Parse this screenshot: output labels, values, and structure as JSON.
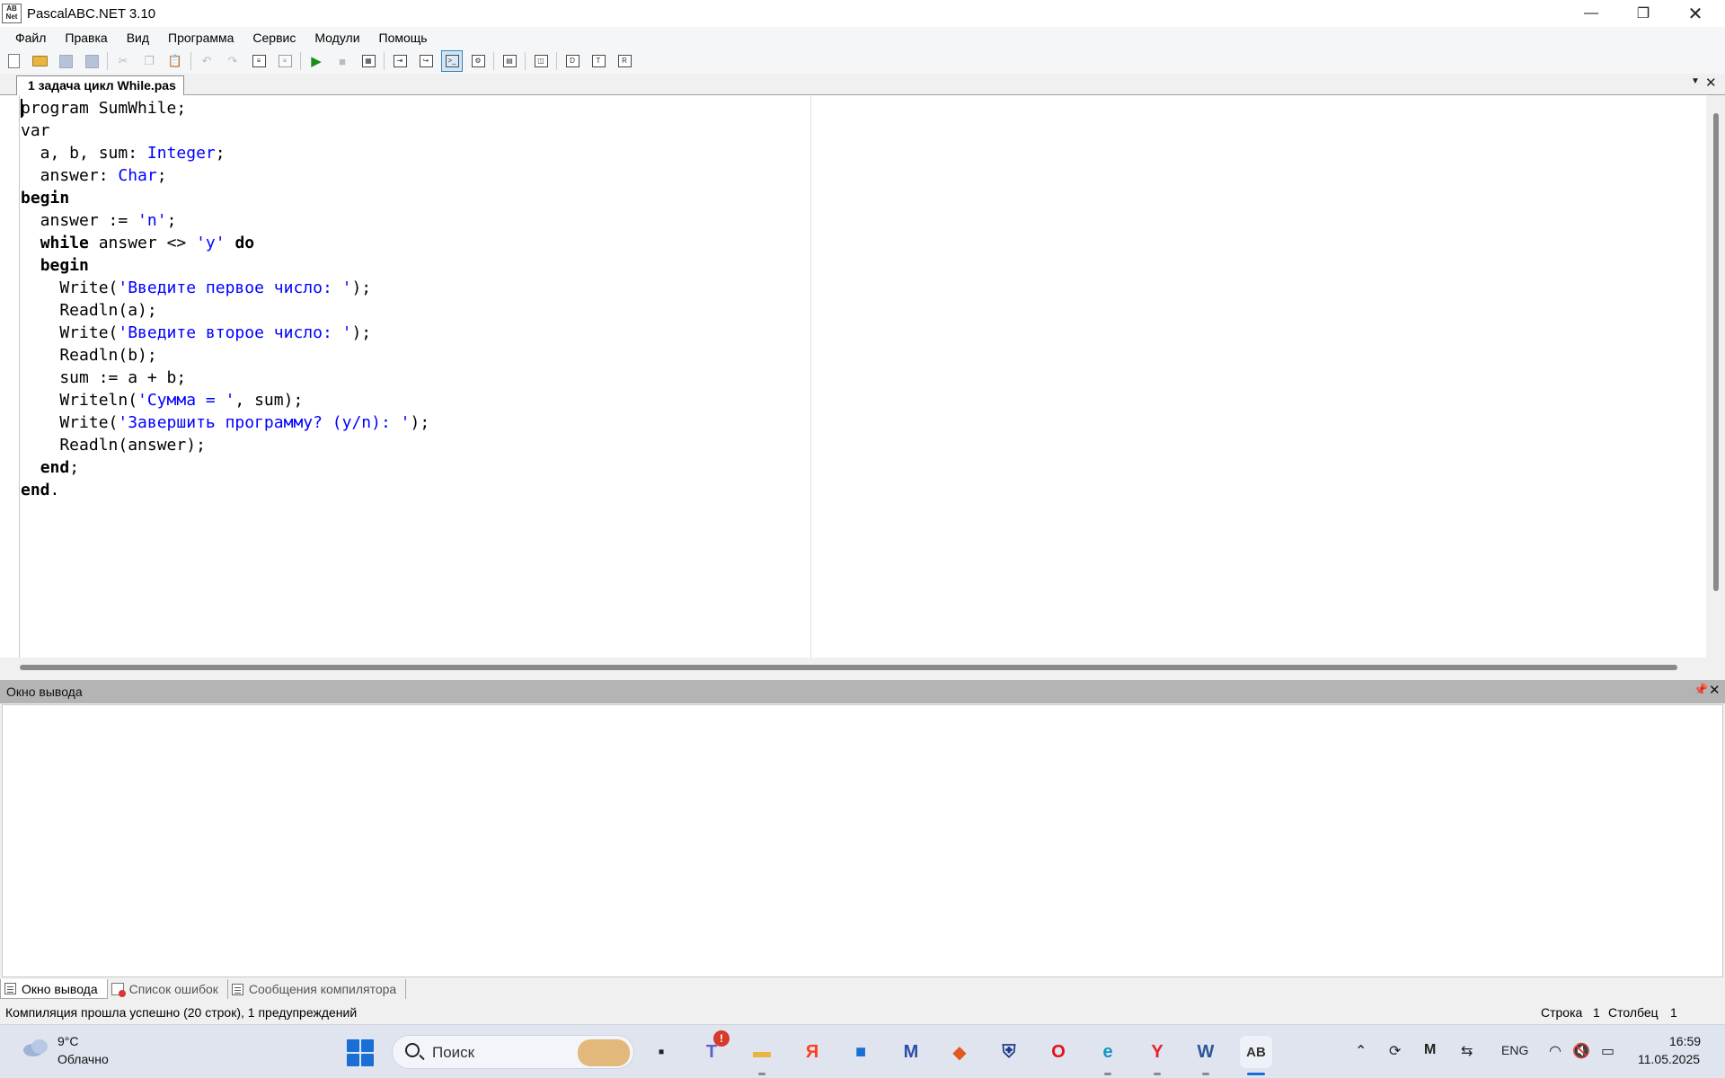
{
  "window": {
    "title": "PascalABC.NET 3.10",
    "logo_text": "AB Net",
    "min_glyph": "—",
    "max_glyph": "❐",
    "close_glyph": "✕"
  },
  "menu": [
    "Файл",
    "Правка",
    "Вид",
    "Программа",
    "Сервис",
    "Модули",
    "Помощь"
  ],
  "toolbar": {
    "icons": [
      "new-file-icon",
      "open-folder-icon",
      "save-icon",
      "save-all-icon",
      "cut-icon",
      "copy-icon",
      "paste-icon",
      "undo-icon",
      "redo-icon",
      "find-icon",
      "replace-icon",
      "run-icon",
      "stop-icon",
      "compile-icon",
      "step-into-icon",
      "step-over-icon",
      "console-icon",
      "debug-icon",
      "form-icon",
      "unit-icon",
      "doc1-icon",
      "doc2-icon",
      "doc3-icon"
    ]
  },
  "editor": {
    "tab_label": "1 задача цикл While.pas",
    "tab_menu_glyph": "▼",
    "tab_close_glyph": "✕",
    "colors": {
      "keyword": "#000000",
      "type": "#0000ff",
      "string": "#0000ff",
      "plain": "#000000"
    },
    "code_lines": [
      [
        {
          "t": "program SumWhile;",
          "k": "p"
        }
      ],
      [
        {
          "t": "var",
          "k": "p"
        }
      ],
      [
        {
          "t": "  a, b, sum: ",
          "k": "p"
        },
        {
          "t": "Integer",
          "k": "ty"
        },
        {
          "t": ";",
          "k": "p"
        }
      ],
      [
        {
          "t": "  answer: ",
          "k": "p"
        },
        {
          "t": "Char",
          "k": "ty"
        },
        {
          "t": ";",
          "k": "p"
        }
      ],
      [
        {
          "t": "begin",
          "k": "kw"
        }
      ],
      [
        {
          "t": "  answer := ",
          "k": "p"
        },
        {
          "t": "'n'",
          "k": "st"
        },
        {
          "t": ";",
          "k": "p"
        }
      ],
      [
        {
          "t": "  ",
          "k": "p"
        },
        {
          "t": "while",
          "k": "kw"
        },
        {
          "t": " answer <> ",
          "k": "p"
        },
        {
          "t": "'y'",
          "k": "st"
        },
        {
          "t": " ",
          "k": "p"
        },
        {
          "t": "do",
          "k": "kw"
        }
      ],
      [
        {
          "t": "  ",
          "k": "p"
        },
        {
          "t": "begin",
          "k": "kw"
        }
      ],
      [
        {
          "t": "    Write(",
          "k": "p"
        },
        {
          "t": "'Введите первое число: '",
          "k": "st"
        },
        {
          "t": ");",
          "k": "p"
        }
      ],
      [
        {
          "t": "    Readln(a);",
          "k": "p"
        }
      ],
      [
        {
          "t": "    Write(",
          "k": "p"
        },
        {
          "t": "'Введите второе число: '",
          "k": "st"
        },
        {
          "t": ");",
          "k": "p"
        }
      ],
      [
        {
          "t": "    Readln(b);",
          "k": "p"
        }
      ],
      [
        {
          "t": "    sum := a + b;",
          "k": "p"
        }
      ],
      [
        {
          "t": "    Writeln(",
          "k": "p"
        },
        {
          "t": "'Сумма = '",
          "k": "st"
        },
        {
          "t": ", sum);",
          "k": "p"
        }
      ],
      [
        {
          "t": "    Write(",
          "k": "p"
        },
        {
          "t": "'Завершить программу? (y/n): '",
          "k": "st"
        },
        {
          "t": ");",
          "k": "p"
        }
      ],
      [
        {
          "t": "    Readln(answer);",
          "k": "p"
        }
      ],
      [
        {
          "t": "  ",
          "k": "p"
        },
        {
          "t": "end",
          "k": "kw"
        },
        {
          "t": ";",
          "k": "p"
        }
      ],
      [
        {
          "t": "end",
          "k": "kw"
        },
        {
          "t": ".",
          "k": "p"
        }
      ]
    ]
  },
  "output": {
    "title": "Окно вывода",
    "pin_glyph": "📌",
    "close_glyph": "✕"
  },
  "bottom_tabs": [
    "Окно вывода",
    "Список ошибок",
    "Сообщения компилятора"
  ],
  "status": {
    "message": "Компиляция прошла успешно (20 строк), 1 предупреждений",
    "line_label": "Строка",
    "line_value": "1",
    "col_label": "Столбец",
    "col_value": "1"
  },
  "taskbar": {
    "weather_temp": "9°C",
    "weather_desc": "Облачно",
    "search_placeholder": "Поиск",
    "badge": "!",
    "apps": [
      {
        "name": "task-view-icon",
        "glyph": "▪",
        "color": "#222222"
      },
      {
        "name": "teams-icon",
        "glyph": "T",
        "color": "#5b5fc7"
      },
      {
        "name": "file-explorer-icon",
        "glyph": "▬",
        "color": "#e8b640"
      },
      {
        "name": "yandex-browser-icon",
        "glyph": "Я",
        "color": "#fc3f1d"
      },
      {
        "name": "store-icon",
        "glyph": "■",
        "color": "#1a6fd6"
      },
      {
        "name": "app-m-icon",
        "glyph": "M",
        "color": "#2b4fa8"
      },
      {
        "name": "app-shield-icon",
        "glyph": "◆",
        "color": "#e05a1c"
      },
      {
        "name": "app-emblem-icon",
        "glyph": "⛨",
        "color": "#1c3a8a"
      },
      {
        "name": "opera-icon",
        "glyph": "O",
        "color": "#e0101e"
      },
      {
        "name": "edge-icon",
        "glyph": "e",
        "color": "#1595c9"
      },
      {
        "name": "yandex-icon",
        "glyph": "Y",
        "color": "#e8202c"
      },
      {
        "name": "word-icon",
        "glyph": "W",
        "color": "#2b579a"
      },
      {
        "name": "pascalabc-icon",
        "glyph": "AB",
        "color": "#333333"
      }
    ],
    "tray": {
      "chevron": "⌃",
      "lang": "ENG",
      "wifi": "◠",
      "volume": "🔇",
      "battery": "▭"
    },
    "time": "16:59",
    "date": "11.05.2025"
  }
}
